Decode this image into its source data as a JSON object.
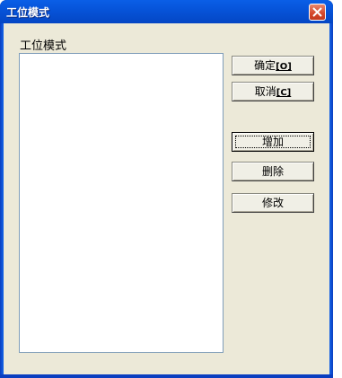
{
  "window": {
    "title": "工位模式",
    "close_icon": "close-icon"
  },
  "list": {
    "label": "工位模式",
    "items": []
  },
  "buttons": {
    "ok": {
      "label": "确定",
      "shortcut": "[O]"
    },
    "cancel": {
      "label": "取消",
      "shortcut": "[C]"
    },
    "add": {
      "label": "增加"
    },
    "delete": {
      "label": "删除"
    },
    "modify": {
      "label": "修改"
    }
  },
  "colors": {
    "titlebar": "#0653d8",
    "client": "#ece9d8",
    "close": "#d4462a"
  }
}
